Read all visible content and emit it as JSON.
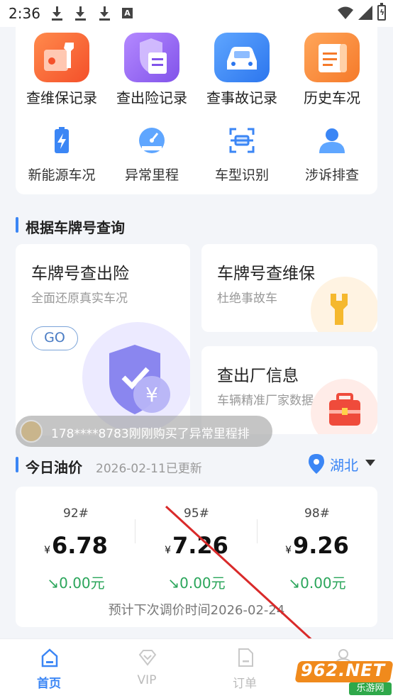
{
  "status_bar": {
    "time": "2:36"
  },
  "tools": {
    "primary": [
      {
        "label": "查维保记录",
        "icon": "wrench-document-icon",
        "color": "#f56a3a"
      },
      {
        "label": "查出险记录",
        "icon": "shield-document-icon",
        "color": "#9b6cf0"
      },
      {
        "label": "查事故记录",
        "icon": "car-icon",
        "color": "#3b86f5"
      },
      {
        "label": "历史车况",
        "icon": "scroll-icon",
        "color": "#f58a3a"
      }
    ],
    "secondary": [
      {
        "label": "新能源车况",
        "icon": "battery-icon"
      },
      {
        "label": "异常里程",
        "icon": "speedometer-icon"
      },
      {
        "label": "车型识别",
        "icon": "scan-icon"
      },
      {
        "label": "涉诉排查",
        "icon": "person-icon"
      }
    ]
  },
  "plate_section": {
    "title": "根据车牌号查询",
    "insurance": {
      "title": "车牌号查出险",
      "subtitle": "全面还原真实车况",
      "go": "GO",
      "icon": "shield-yuan-icon"
    },
    "maintenance": {
      "title": "车牌号查维保",
      "subtitle": "杜绝事故车",
      "icon": "wrench-icon"
    },
    "factory": {
      "title": "查出厂信息",
      "subtitle": "车辆精准厂家数据",
      "icon": "toolbox-icon"
    }
  },
  "toast": {
    "text": "178****8783刚刚购买了异常里程排"
  },
  "oil": {
    "title": "今日油价",
    "updated": "2026-02-11已更新",
    "region": "湖北",
    "prices": [
      {
        "grade": "92#",
        "currency": "¥",
        "price": "6.78",
        "change": "0.00元"
      },
      {
        "grade": "95#",
        "currency": "¥",
        "price": "7.26",
        "change": "0.00元"
      },
      {
        "grade": "98#",
        "currency": "¥",
        "price": "9.26",
        "change": "0.00元"
      }
    ],
    "next_adjust": "预计下次调价时间2026-02-24"
  },
  "nav": [
    {
      "label": "首页",
      "icon": "home-icon",
      "active": true
    },
    {
      "label": "VIP",
      "icon": "diamond-icon",
      "active": false
    },
    {
      "label": "订单",
      "icon": "order-icon",
      "active": false
    },
    {
      "label": "",
      "icon": "profile-icon",
      "active": false
    }
  ],
  "watermark": {
    "text": "962.NET",
    "sub": "乐游网"
  }
}
